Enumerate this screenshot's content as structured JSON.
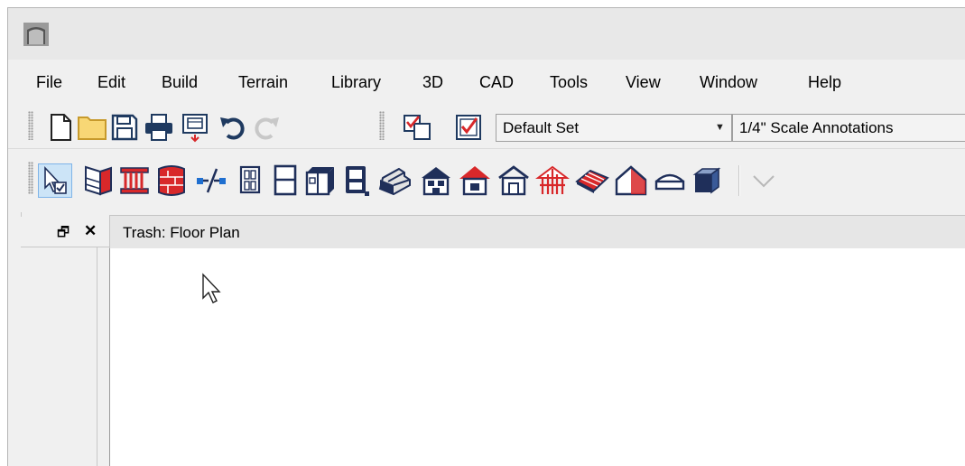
{
  "menu": {
    "file": "File",
    "edit": "Edit",
    "build": "Build",
    "terrain": "Terrain",
    "library": "Library",
    "three_d": "3D",
    "cad": "CAD",
    "tools": "Tools",
    "view": "View",
    "window": "Window",
    "help": "Help"
  },
  "toolbar1": {
    "layer_set": "Default Set",
    "annotation_set": "1/4\" Scale Annotations"
  },
  "sidebar": {
    "float_icon": "🗗",
    "close_icon": "✕"
  },
  "view_tab": {
    "title": "Trash: Floor Plan"
  },
  "colors": {
    "accent_red": "#d8282a",
    "toolbar_bg": "#f0f0f0",
    "icon_dark": "#1f2f5a"
  }
}
